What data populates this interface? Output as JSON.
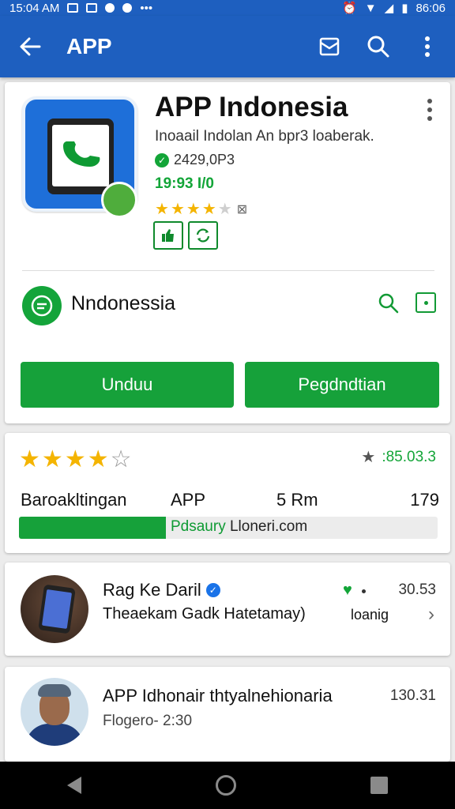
{
  "colors": {
    "app_bar": "#1e5fbf",
    "accent_green": "#16a13a",
    "star": "#f4b400"
  },
  "status_bar": {
    "time": "15:04 AM",
    "battery": "86:06"
  },
  "app_bar": {
    "title": "APP",
    "icons": [
      "back-arrow-icon",
      "mail-icon",
      "search-icon",
      "more-vert-icon"
    ]
  },
  "app": {
    "name": "APP Indonesia",
    "subtitle": "Inoaail Indolan An bpr3 loaberak.",
    "meta1": "2429,0P3",
    "meta2": "19:93 I/0",
    "rating": 4.0,
    "rating_suffix": "⊠"
  },
  "developer": {
    "name": "Nndonessia"
  },
  "buttons": {
    "install": "Unduu",
    "open": "Pegdndtian"
  },
  "ratings": {
    "stars": 4,
    "score": ":85.03.3",
    "labels": {
      "a": "Baroakltingan",
      "b": "APP",
      "c": "5 Rm",
      "d": "179"
    },
    "progress": 0.35,
    "progress_text_hl": "Pdsaury",
    "progress_text": " Lloneri.com"
  },
  "reviews": [
    {
      "title": "Rag Ke Daril",
      "subtitle": "Theaekam Gadk Hatetamay)",
      "count": "30.53",
      "side": "loanig"
    },
    {
      "title": "APP Idhonair thtyalnehionaria",
      "subtitle": "Flogero- 2:30",
      "count": "130.31"
    }
  ]
}
